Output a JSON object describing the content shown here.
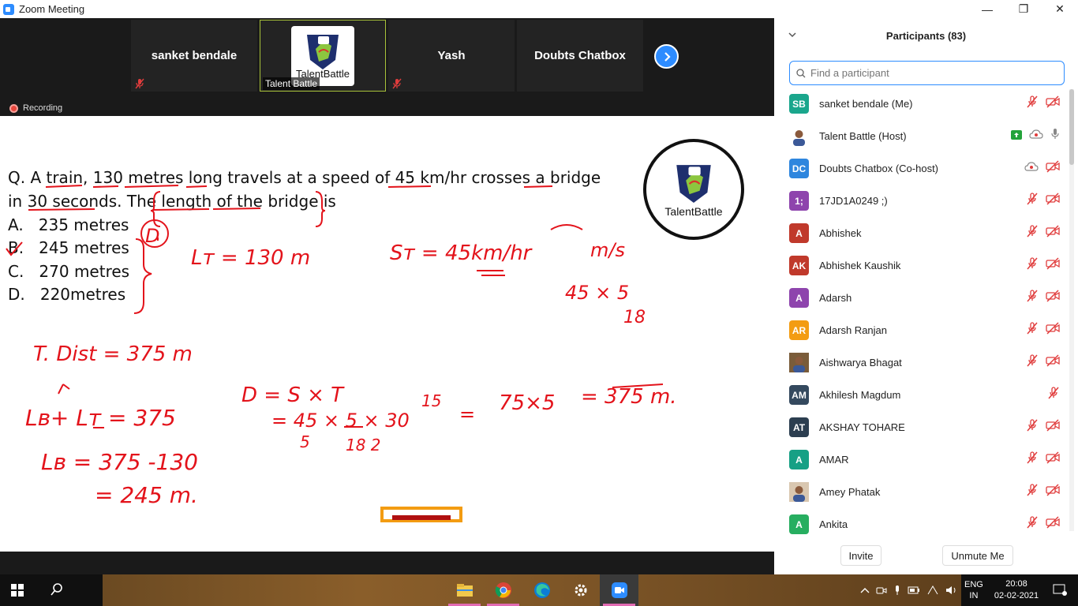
{
  "window": {
    "title": "Zoom Meeting",
    "minimize": "—",
    "restore": "❐",
    "close": "✕"
  },
  "gallery": {
    "tiles": [
      {
        "label": "sanket bendale",
        "muted": true
      },
      {
        "label": "Talent Battle",
        "muted": false,
        "logo": "TalentBattle"
      },
      {
        "label": "Yash",
        "muted": true
      },
      {
        "label": "Doubts Chatbox",
        "muted": false
      }
    ],
    "next_icon": "chevron-right-icon"
  },
  "recording": {
    "label": "Recording"
  },
  "board": {
    "question_line1": "Q. A train, 130 metres long travels at a speed of 45 km/hr crosses a bridge",
    "question_line2": "in 30 seconds. The length of the bridge is",
    "options": [
      {
        "letter": "A.",
        "text": "235 metres"
      },
      {
        "letter": "B.",
        "text": "245 metres"
      },
      {
        "letter": "C.",
        "text": "270 metres"
      },
      {
        "letter": "D.",
        "text": "220metres"
      }
    ],
    "logo_text": "TalentBattle",
    "ink_color": "#e3131b",
    "handwriting": {
      "answer_mark": "D",
      "lt": "Lᴛ = 130 m",
      "st": "Sᴛ = 45km/hr",
      "ms": "m/s",
      "conv": "45 × 5",
      "conv_den": "18",
      "tdist": "T. Dist = 375 m",
      "eq1": "Lʙ+ Lᴛ = 375",
      "eq2": "Lʙ = 375 -130",
      "eq3": "= 245 m.",
      "d1": "D = S × T",
      "d2a": "= 45 × 5 × 30",
      "d2b": "15",
      "d2c": "=",
      "d2d": "75×5",
      "d2e": "= 375 m.",
      "d2n1": "5",
      "d2n2": "18 2"
    }
  },
  "panel": {
    "title": "Participants (83)",
    "search_placeholder": "Find a participant",
    "participants": [
      {
        "initials": "SB",
        "name": "sanket bendale (Me)",
        "color": "#1aa68c",
        "icons": [
          "mic-off-icon",
          "video-off-icon"
        ]
      },
      {
        "initials": "",
        "name": "Talent Battle (Host)",
        "color": "#ffffff",
        "photo": true,
        "icons": [
          "share-screen-icon",
          "cloud-record-icon",
          "mic-icon"
        ]
      },
      {
        "initials": "DC",
        "name": "Doubts Chatbox (Co-host)",
        "color": "#2e86de",
        "icons": [
          "cloud-record-icon",
          "video-off-icon"
        ]
      },
      {
        "initials": "1;",
        "name": "17JD1A0249 ;)",
        "color": "#8e44ad",
        "icons": [
          "mic-off-icon",
          "video-off-icon"
        ]
      },
      {
        "initials": "A",
        "name": "Abhishek",
        "color": "#c0392b",
        "icons": [
          "mic-off-icon",
          "video-off-icon"
        ]
      },
      {
        "initials": "AK",
        "name": "Abhishek Kaushik",
        "color": "#c0392b",
        "icons": [
          "mic-off-icon",
          "video-off-icon"
        ]
      },
      {
        "initials": "A",
        "name": "Adarsh",
        "color": "#8e44ad",
        "icons": [
          "mic-off-icon",
          "video-off-icon"
        ]
      },
      {
        "initials": "AR",
        "name": "Adarsh Ranjan",
        "color": "#f39c12",
        "icons": [
          "mic-off-icon",
          "video-off-icon"
        ]
      },
      {
        "initials": "",
        "name": "Aishwarya Bhagat",
        "color": "#7a5c3a",
        "photo": true,
        "icons": [
          "mic-off-icon",
          "video-off-icon"
        ]
      },
      {
        "initials": "AM",
        "name": "Akhilesh Magdum",
        "color": "#34495e",
        "icons": [
          "mic-off-icon"
        ]
      },
      {
        "initials": "AT",
        "name": "AKSHAY TOHARE",
        "color": "#2c3e50",
        "icons": [
          "mic-off-icon",
          "video-off-icon"
        ]
      },
      {
        "initials": "A",
        "name": "AMAR",
        "color": "#16a085",
        "icons": [
          "mic-off-icon",
          "video-off-icon"
        ]
      },
      {
        "initials": "",
        "name": "Amey Phatak",
        "color": "#d9c7b0",
        "photo": true,
        "icons": [
          "mic-off-icon",
          "video-off-icon"
        ]
      },
      {
        "initials": "A",
        "name": "Ankita",
        "color": "#27ae60",
        "icons": [
          "mic-off-icon",
          "video-off-icon"
        ]
      }
    ],
    "invite_label": "Invite",
    "unmute_label": "Unmute Me"
  },
  "taskbar": {
    "apps": [
      "file-explorer-icon",
      "chrome-icon",
      "edge-icon",
      "settings-icon",
      "zoom-icon"
    ],
    "lang_top": "ENG",
    "lang_bottom": "IN",
    "time": "20:08",
    "date": "02-02-2021"
  }
}
